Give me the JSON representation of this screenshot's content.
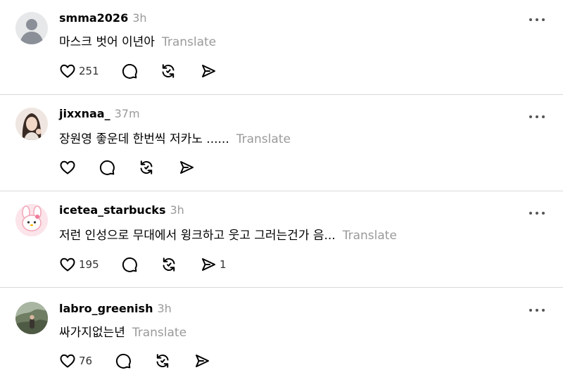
{
  "posts": [
    {
      "username": "smma2026",
      "time": "3h",
      "text": "마스크 벗어 이년아",
      "translate": "Translate",
      "likes": "251",
      "shares": "",
      "avatar": "default-avatar"
    },
    {
      "username": "jixxnaa_",
      "time": "37m",
      "text": "장원영 좋운데 한번씩 저카노 ......",
      "translate": "Translate",
      "likes": "",
      "shares": "",
      "avatar": "photo-avatar"
    },
    {
      "username": "icetea_starbucks",
      "time": "3h",
      "text": "저런 인성으로 무대에서 윙크하고 웃고 그러는건가 음...",
      "translate": "Translate",
      "likes": "195",
      "shares": "1",
      "avatar": "character-avatar"
    },
    {
      "username": "labro_greenish",
      "time": "3h",
      "text": "싸가지없는년",
      "translate": "Translate",
      "likes": "76",
      "shares": "",
      "avatar": "photo-avatar"
    }
  ],
  "icons": {
    "like": "heart-icon",
    "comment": "comment-icon",
    "repost": "repost-icon",
    "share": "share-icon",
    "more": "more-options-icon"
  },
  "colors": {
    "secondary_text": "#9a9a9a",
    "divider": "#d9d9d9"
  }
}
